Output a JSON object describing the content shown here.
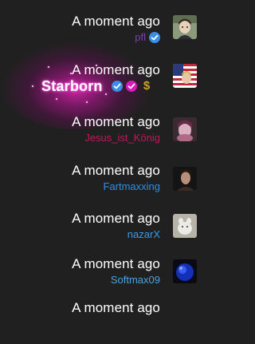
{
  "feed": {
    "items": [
      {
        "time": "A moment ago",
        "username": "pfl",
        "name_color": "#7b3fb0",
        "badges": [
          "verified-icon"
        ],
        "avatar": "anime-portrait-avatar"
      },
      {
        "time": "A moment ago",
        "username": "Starborn",
        "name_color": "#ffffff",
        "badges": [
          "verified-icon",
          "heart-badge-icon",
          "dollar-icon"
        ],
        "avatar": "us-flag-avatar"
      },
      {
        "time": "A moment ago",
        "username": "Jesus_ist_König",
        "name_color": "#c2185b",
        "badges": [],
        "avatar": "pink-portrait-avatar"
      },
      {
        "time": "A moment ago",
        "username": "Fartmaxxing",
        "name_color": "#2f8fe6",
        "badges": [],
        "avatar": "dark-portrait-avatar"
      },
      {
        "time": "A moment ago",
        "username": "nazarX",
        "name_color": "#3b9ae8",
        "badges": [],
        "avatar": "white-animal-avatar"
      },
      {
        "time": "A moment ago",
        "username": "Softmax09",
        "name_color": "#4aa3e0",
        "badges": [],
        "avatar": "blue-orb-avatar"
      },
      {
        "time": "A moment ago"
      }
    ],
    "dollar_symbol": "$"
  },
  "colors": {
    "background": "#202020",
    "verified": "#3a8ee6",
    "heart_badge": "#d81bb8",
    "glow": "#ff28c8",
    "dollar": "#c9a227"
  }
}
